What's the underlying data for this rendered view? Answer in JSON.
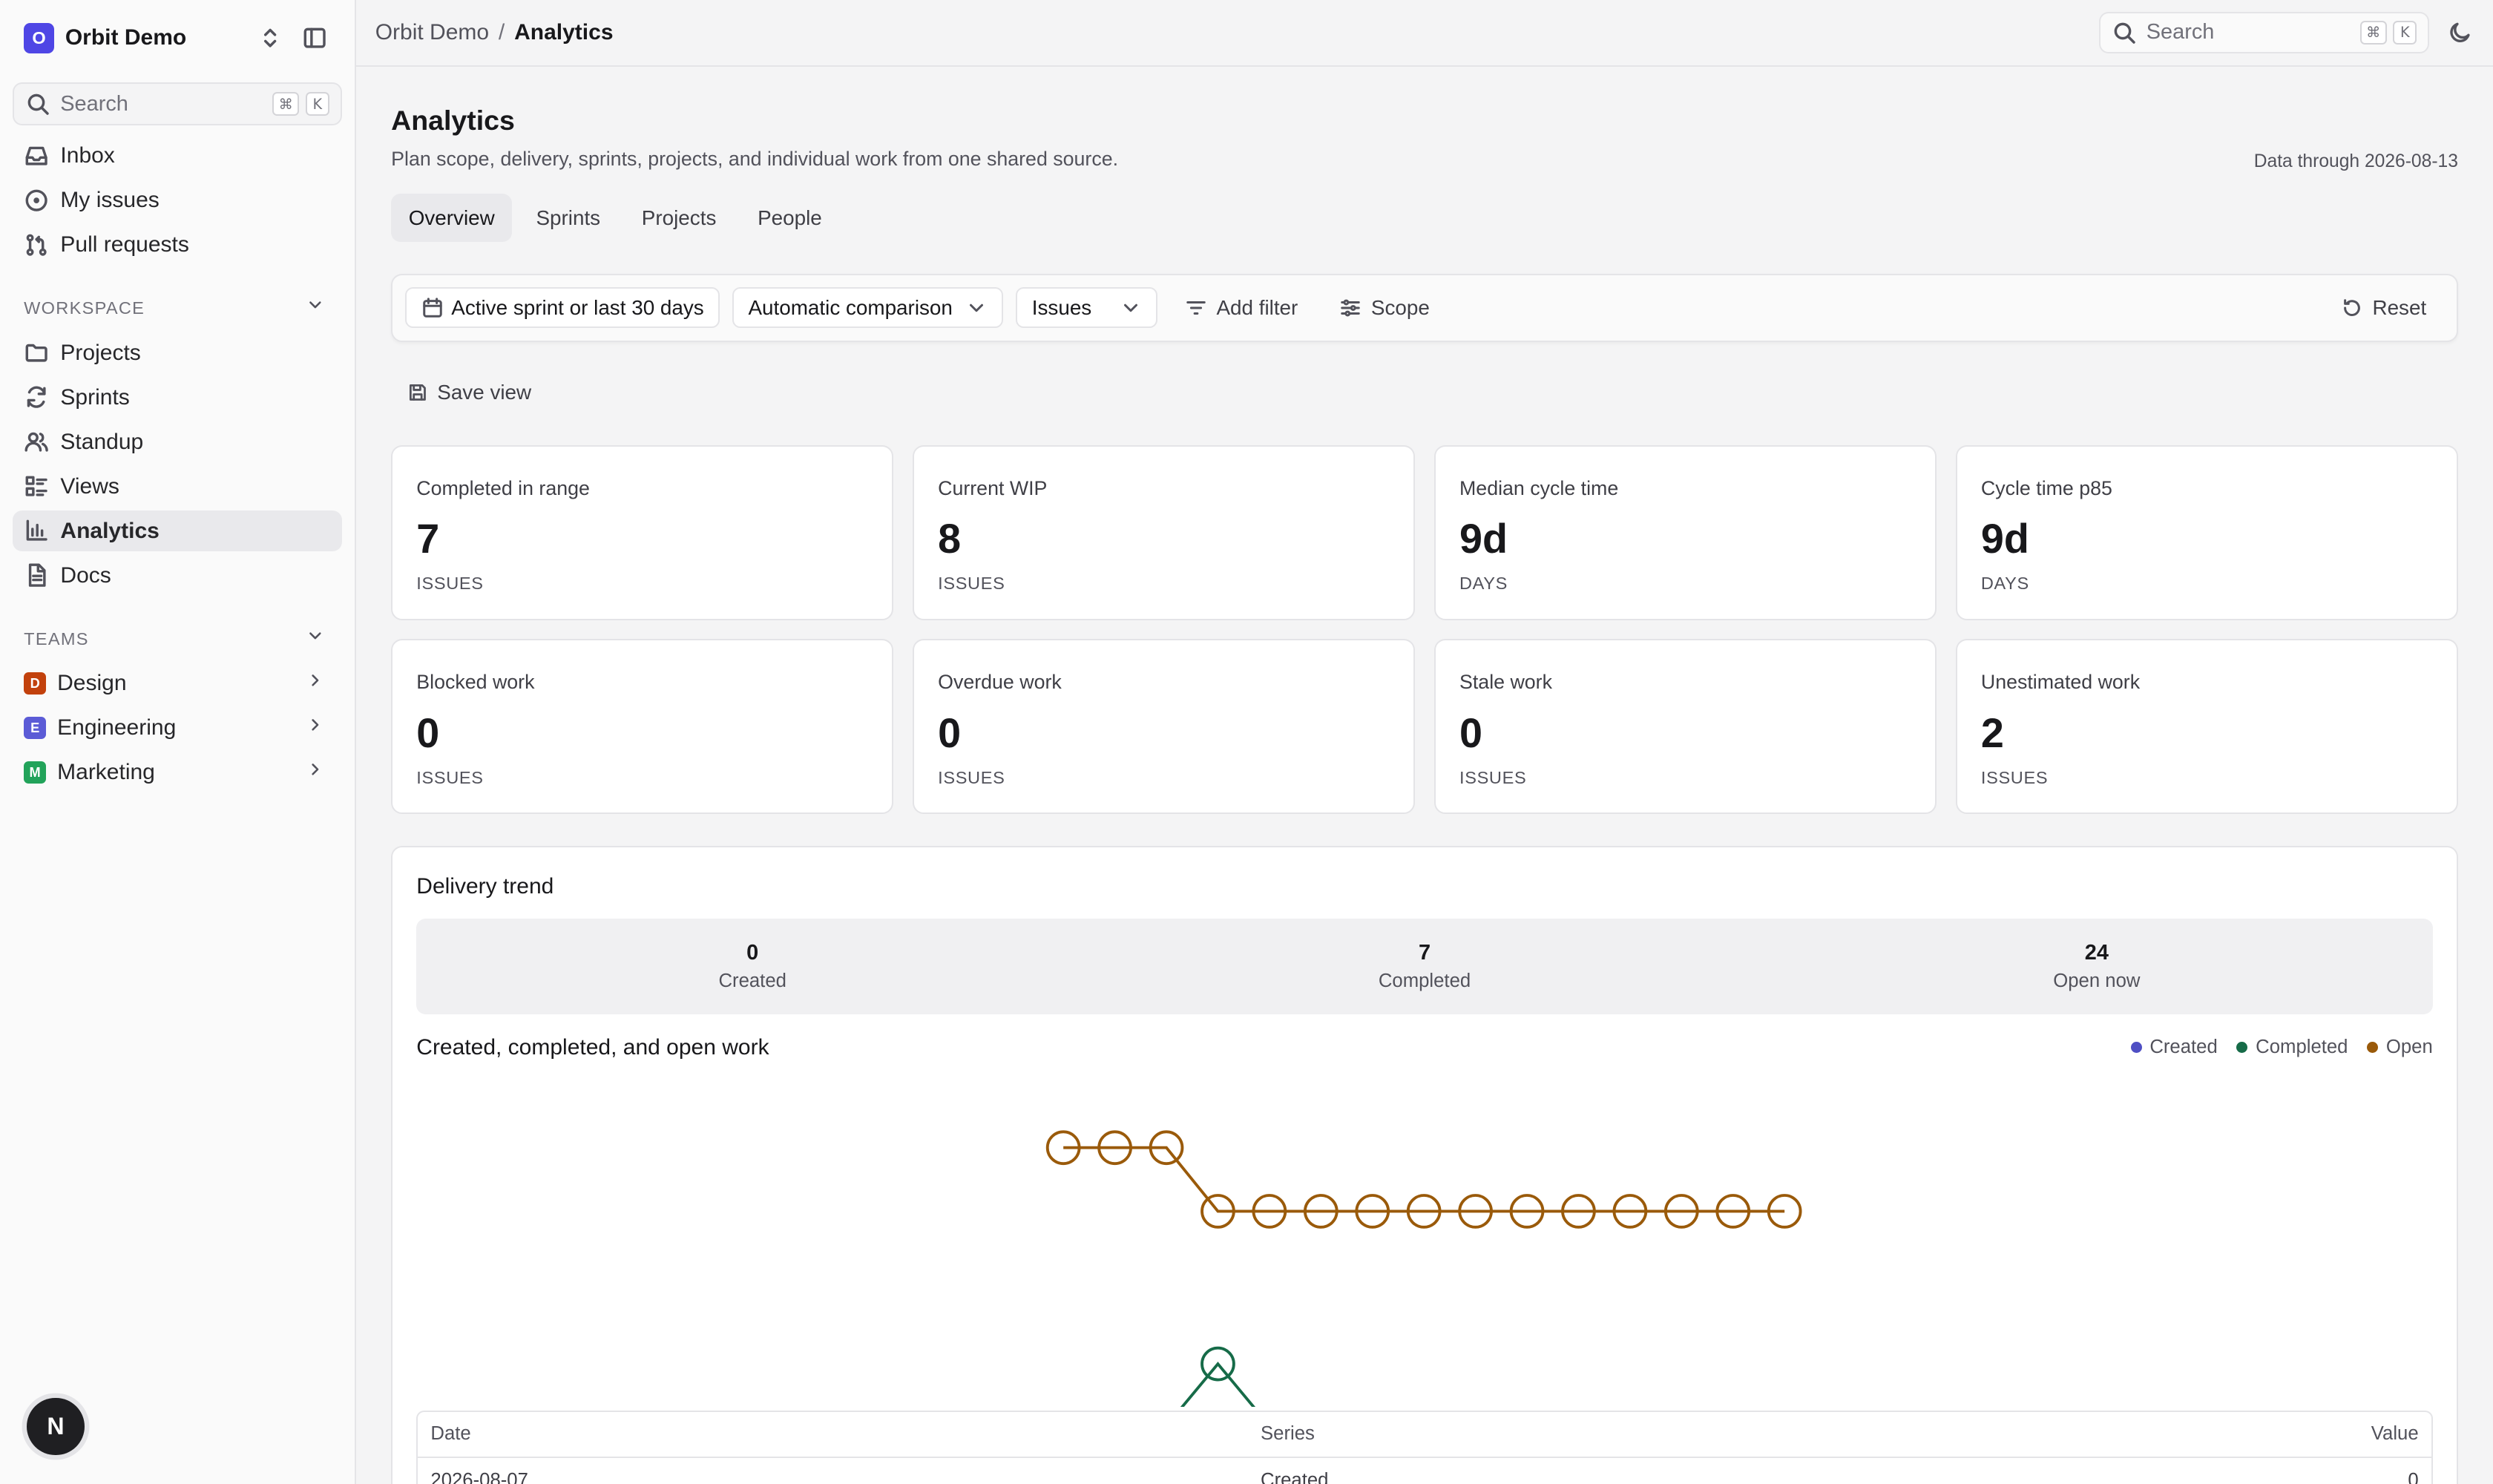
{
  "workspace": {
    "initial": "O",
    "name": "Orbit Demo"
  },
  "sidebar": {
    "search": {
      "label": "Search",
      "keys": [
        "⌘",
        "K"
      ]
    },
    "top_items": [
      {
        "label": "Inbox",
        "icon": "inbox-icon"
      },
      {
        "label": "My issues",
        "icon": "circle-dot-icon"
      },
      {
        "label": "Pull requests",
        "icon": "git-pull-request-icon"
      }
    ],
    "workspace_section": "WORKSPACE",
    "workspace_items": [
      {
        "label": "Projects",
        "icon": "folder-icon"
      },
      {
        "label": "Sprints",
        "icon": "refresh-icon"
      },
      {
        "label": "Standup",
        "icon": "users-icon"
      },
      {
        "label": "Views",
        "icon": "layout-icon"
      },
      {
        "label": "Analytics",
        "icon": "bar-chart-icon",
        "active": true
      },
      {
        "label": "Docs",
        "icon": "file-icon"
      }
    ],
    "teams_section": "TEAMS",
    "teams": [
      {
        "initial": "D",
        "label": "Design",
        "color": "#c2410c"
      },
      {
        "initial": "E",
        "label": "Engineering",
        "color": "#5b5bd6"
      },
      {
        "initial": "M",
        "label": "Marketing",
        "color": "#22a35a"
      }
    ],
    "avatar_initial": "N"
  },
  "topbar": {
    "breadcrumb_root": "Orbit Demo",
    "breadcrumb_sep": "/",
    "breadcrumb_current": "Analytics",
    "search": {
      "label": "Search",
      "keys": [
        "⌘",
        "K"
      ]
    }
  },
  "page": {
    "title": "Analytics",
    "subtitle": "Plan scope, delivery, sprints, projects, and individual work from one shared source.",
    "data_through": "Data through 2026-08-13",
    "tabs": [
      "Overview",
      "Sprints",
      "Projects",
      "People"
    ],
    "active_tab": "Overview"
  },
  "filters": {
    "range": "Active sprint or last 30 days",
    "comparison": "Automatic comparison",
    "entity": "Issues",
    "add_filter": "Add filter",
    "scope": "Scope",
    "reset": "Reset",
    "save_view": "Save view"
  },
  "metrics": [
    {
      "title": "Completed in range",
      "value": "7",
      "unit": "ISSUES"
    },
    {
      "title": "Current WIP",
      "value": "8",
      "unit": "ISSUES"
    },
    {
      "title": "Median cycle time",
      "value": "9d",
      "unit": "DAYS"
    },
    {
      "title": "Cycle time p85",
      "value": "9d",
      "unit": "DAYS"
    },
    {
      "title": "Blocked work",
      "value": "0",
      "unit": "ISSUES"
    },
    {
      "title": "Overdue work",
      "value": "0",
      "unit": "ISSUES"
    },
    {
      "title": "Stale work",
      "value": "0",
      "unit": "ISSUES"
    },
    {
      "title": "Unestimated work",
      "value": "2",
      "unit": "ISSUES"
    }
  ],
  "delivery": {
    "title": "Delivery trend",
    "summary": [
      {
        "value": "0",
        "label": "Created"
      },
      {
        "value": "7",
        "label": "Completed"
      },
      {
        "value": "24",
        "label": "Open now"
      }
    ],
    "table": {
      "headers": [
        "Date",
        "Series",
        "Value"
      ],
      "rows": [
        {
          "date": "2026-08-07",
          "series": "Created",
          "value": "0"
        }
      ]
    }
  },
  "chart_data": {
    "type": "line",
    "title": "Created, completed, and open work",
    "legend_position": "top-right",
    "x": [
      "p1",
      "p2",
      "p3",
      "p4",
      "p5",
      "p6",
      "p7",
      "p8",
      "p9",
      "p10",
      "p11",
      "p12",
      "p13",
      "p14",
      "p15"
    ],
    "ylim": [
      0,
      25
    ],
    "series": [
      {
        "name": "Created",
        "color": "#4f4fc4",
        "values": [
          0,
          0,
          0,
          0,
          0,
          0,
          0,
          0,
          0,
          0,
          0,
          0,
          0,
          0,
          0
        ]
      },
      {
        "name": "Completed",
        "color": "#166b48",
        "values": [
          0,
          0,
          0,
          1,
          0,
          0,
          0,
          0,
          0,
          0,
          0,
          0,
          0,
          0,
          0
        ]
      },
      {
        "name": "Open",
        "color": "#9a5a0a",
        "values": [
          4.5,
          4.5,
          4.5,
          3.5,
          3.5,
          3.5,
          3.5,
          3.5,
          3.5,
          3.5,
          3.5,
          3.5,
          3.5,
          3.5,
          3.5
        ]
      }
    ]
  }
}
